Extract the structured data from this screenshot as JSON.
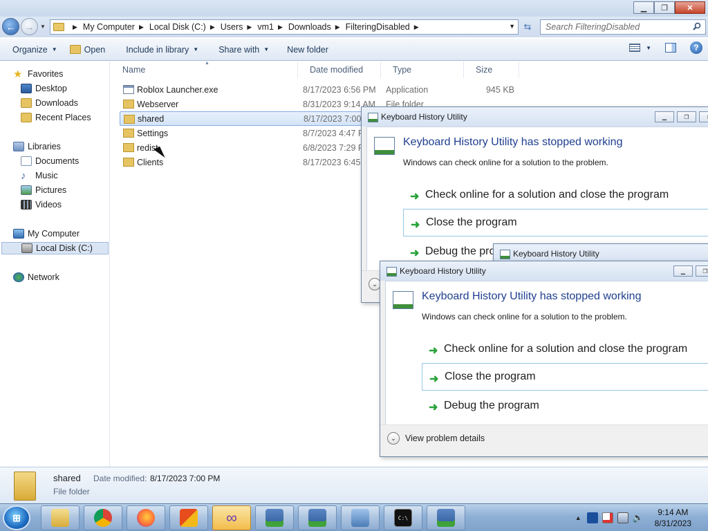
{
  "window": {
    "address": [
      "My Computer",
      "Local Disk (C:)",
      "Users",
      "vm1",
      "Downloads",
      "FilteringDisabled"
    ],
    "search_placeholder": "Search FilteringDisabled"
  },
  "toolbar": {
    "organize": "Organize",
    "open": "Open",
    "include_in_library": "Include in library",
    "share_with": "Share with",
    "new_folder": "New folder"
  },
  "nav": {
    "favorites": "Favorites",
    "desktop": "Desktop",
    "downloads": "Downloads",
    "recent_places": "Recent Places",
    "libraries": "Libraries",
    "documents": "Documents",
    "music": "Music",
    "pictures": "Pictures",
    "videos": "Videos",
    "my_computer": "My Computer",
    "local_disk": "Local Disk (C:)",
    "network": "Network"
  },
  "columns": {
    "name": "Name",
    "date_modified": "Date modified",
    "type": "Type",
    "size": "Size"
  },
  "files": [
    {
      "name": "Roblox Launcher.exe",
      "date": "8/17/2023 6:56 PM",
      "type": "Application",
      "size": "945 KB",
      "icon": "exe-icon"
    },
    {
      "name": "Webserver",
      "date": "8/31/2023 9:14 AM",
      "type": "File folder",
      "size": "",
      "icon": "folder-icon"
    },
    {
      "name": "shared",
      "date": "8/17/2023 7:00 P",
      "type": "",
      "size": "",
      "icon": "folder-icon"
    },
    {
      "name": "Settings",
      "date": "8/7/2023 4:47 P",
      "type": "",
      "size": "",
      "icon": "folder-icon"
    },
    {
      "name": "redist",
      "date": "6/8/2023 7:29 P",
      "type": "",
      "size": "",
      "icon": "folder-icon"
    },
    {
      "name": "Clients",
      "date": "8/17/2023 6:45 P",
      "type": "",
      "size": "",
      "icon": "folder-icon"
    }
  ],
  "details": {
    "name": "shared",
    "date_label": "Date modified:",
    "date": "8/17/2023 7:00 PM",
    "type": "File folder"
  },
  "dialog_title": "Keyboard History Utility",
  "dialog1": {
    "heading": "Keyboard History Utility has stopped working",
    "sub": "Windows can check online for a solution to the problem.",
    "opt1": "Check online for a solution and close the program",
    "opt2": "Close the program",
    "opt3": "Debug the pro"
  },
  "dialog2": {
    "title": "Keyboard History Utility"
  },
  "dialog3": {
    "heading": "Keyboard History Utility has stopped working",
    "sub": "Windows can check online for a solution to the problem.",
    "opt1": "Check online for a solution and close the program",
    "opt2": "Close the program",
    "opt3": "Debug the program",
    "details": "View problem details"
  },
  "clock": {
    "time": "9:14 AM",
    "date": "8/31/2023"
  },
  "colors": {
    "link_blue": "#1f3f8f",
    "selection": "#d3e4f8",
    "green_arrow": "#28a23a"
  }
}
